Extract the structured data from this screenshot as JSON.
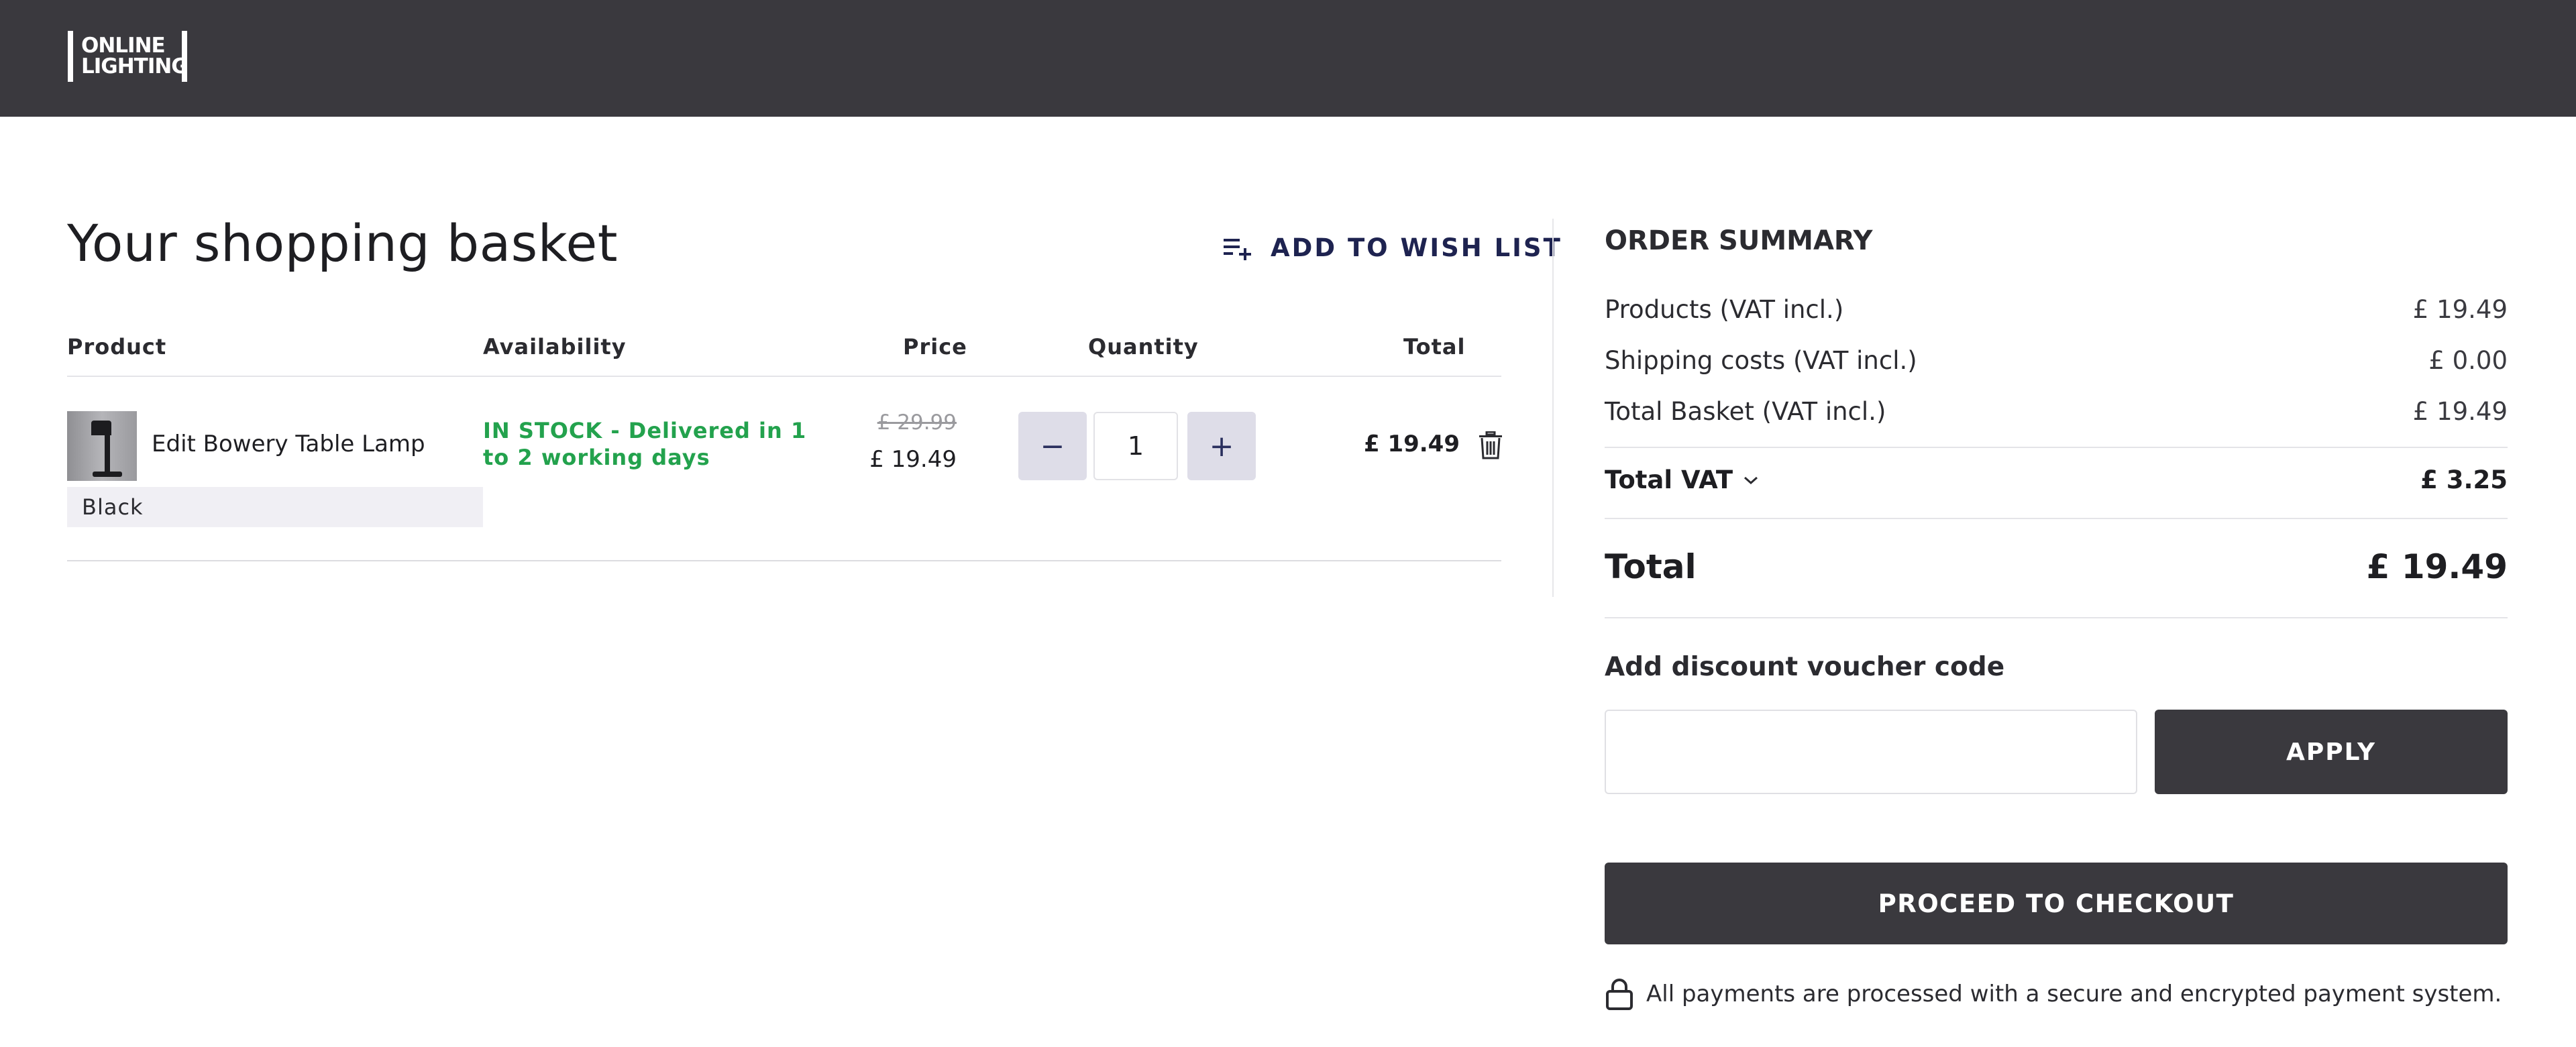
{
  "brand": {
    "logo_line1": "ONLINE",
    "logo_line2": "LIGHTING"
  },
  "basket": {
    "title": "Your shopping basket",
    "wish_list_label": "ADD TO WISH LIST",
    "columns": {
      "product": "Product",
      "availability": "Availability",
      "price": "Price",
      "quantity": "Quantity",
      "total": "Total"
    },
    "items": [
      {
        "name": "Edit Bowery Table Lamp",
        "variant": "Black",
        "availability": "IN STOCK - Delivered in 1 to 2 working days",
        "price_old": "£ 29.99",
        "price": "£ 19.49",
        "quantity": "1",
        "minus_label": "−",
        "plus_label": "+",
        "total": "£ 19.49"
      }
    ]
  },
  "summary": {
    "title": "ORDER SUMMARY",
    "rows": [
      {
        "label": "Products (VAT incl.)",
        "value": "£ 19.49"
      },
      {
        "label": "Shipping costs (VAT incl.)",
        "value": "£ 0.00"
      },
      {
        "label": "Total Basket (VAT incl.)",
        "value": "£ 19.49"
      }
    ],
    "vat": {
      "label": "Total VAT",
      "value": "£ 3.25"
    },
    "total": {
      "label": "Total",
      "value": "£ 19.49"
    },
    "discount_label": "Add discount voucher code",
    "discount_placeholder": "",
    "apply_label": "APPLY",
    "checkout_label": "PROCEED TO CHECKOUT",
    "secure_note": "All payments are processed with a secure and encrypted payment system."
  },
  "colors": {
    "header_bg": "#3a393e",
    "button_dark": "#3a393e",
    "stock_green": "#23a24d",
    "qty_button_bg": "#dedde8",
    "accent_navy": "#1e2350"
  },
  "icons": {
    "wish_list": "playlist-add-icon",
    "delete": "trash-icon",
    "vat_toggle": "chevron-down-icon",
    "secure": "lock-icon"
  }
}
